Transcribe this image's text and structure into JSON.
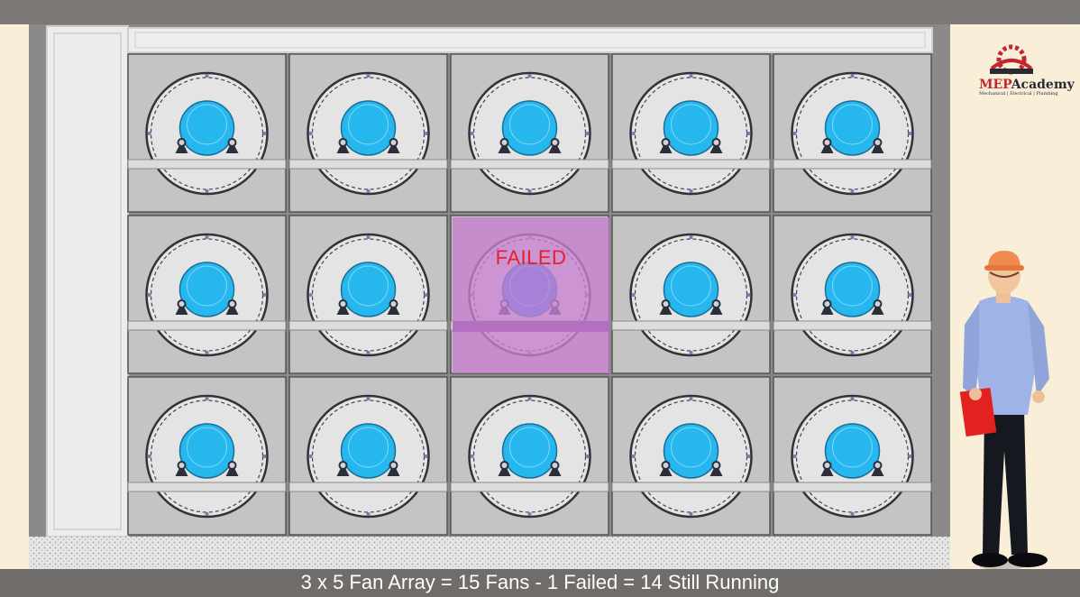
{
  "caption": "3 x 5 Fan Array = 15 Fans - 1 Failed = 14 Still Running",
  "logo": {
    "brand_prefix": "MEP",
    "brand_suffix": "Academy",
    "tagline": "Mechanical | Electrical | Plumbing"
  },
  "fan_array": {
    "rows": 3,
    "columns": 5,
    "total_fans": 15,
    "failed_fans": 1,
    "running_fans": 14,
    "failed_label": "FAILED",
    "failed_position": {
      "row": 2,
      "column": 3
    }
  },
  "colors": {
    "fan_hub": "#25b7ee",
    "failed_hub": "#1f86f2",
    "failed_overlay": "#c77fd0",
    "failed_text": "#e5202a",
    "wall": "#8b8989",
    "caption_bar": "#6f6c69"
  }
}
